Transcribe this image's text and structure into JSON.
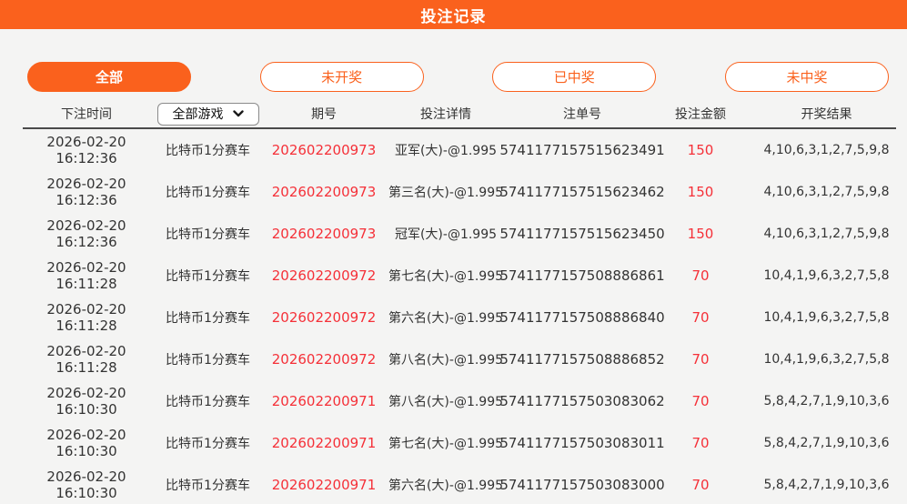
{
  "header": {
    "title": "投注记录"
  },
  "filters": {
    "all": "全部",
    "pending": "未开奖",
    "won": "已中奖",
    "lost": "未中奖"
  },
  "table": {
    "headers": {
      "time": "下注时间",
      "period": "期号",
      "detail": "投注详情",
      "order": "注单号",
      "amount": "投注金额",
      "result": "开奖结果"
    },
    "game_filter": {
      "selected": "全部游戏"
    },
    "rows": [
      {
        "time": "2026-02-20 16:12:36",
        "game": "比特币1分赛车",
        "period": "202602200973",
        "detail": "亚军(大)-@1.995",
        "order": "5741177157515623491",
        "amount": "150",
        "result": "4,10,6,3,1,2,7,5,9,8"
      },
      {
        "time": "2026-02-20 16:12:36",
        "game": "比特币1分赛车",
        "period": "202602200973",
        "detail": "第三名(大)-@1.995",
        "order": "5741177157515623462",
        "amount": "150",
        "result": "4,10,6,3,1,2,7,5,9,8"
      },
      {
        "time": "2026-02-20 16:12:36",
        "game": "比特币1分赛车",
        "period": "202602200973",
        "detail": "冠军(大)-@1.995",
        "order": "5741177157515623450",
        "amount": "150",
        "result": "4,10,6,3,1,2,7,5,9,8"
      },
      {
        "time": "2026-02-20 16:11:28",
        "game": "比特币1分赛车",
        "period": "202602200972",
        "detail": "第七名(大)-@1.995",
        "order": "5741177157508886861",
        "amount": "70",
        "result": "10,4,1,9,6,3,2,7,5,8"
      },
      {
        "time": "2026-02-20 16:11:28",
        "game": "比特币1分赛车",
        "period": "202602200972",
        "detail": "第六名(大)-@1.995",
        "order": "5741177157508886840",
        "amount": "70",
        "result": "10,4,1,9,6,3,2,7,5,8"
      },
      {
        "time": "2026-02-20 16:11:28",
        "game": "比特币1分赛车",
        "period": "202602200972",
        "detail": "第八名(大)-@1.995",
        "order": "5741177157508886852",
        "amount": "70",
        "result": "10,4,1,9,6,3,2,7,5,8"
      },
      {
        "time": "2026-02-20 16:10:30",
        "game": "比特币1分赛车",
        "period": "202602200971",
        "detail": "第八名(大)-@1.995",
        "order": "5741177157503083062",
        "amount": "70",
        "result": "5,8,4,2,7,1,9,10,3,6"
      },
      {
        "time": "2026-02-20 16:10:30",
        "game": "比特币1分赛车",
        "period": "202602200971",
        "detail": "第七名(大)-@1.995",
        "order": "5741177157503083011",
        "amount": "70",
        "result": "5,8,4,2,7,1,9,10,3,6"
      },
      {
        "time": "2026-02-20 16:10:30",
        "game": "比特币1分赛车",
        "period": "202602200971",
        "detail": "第六名(大)-@1.995",
        "order": "5741177157503083000",
        "amount": "70",
        "result": "5,8,4,2,7,1,9,10,3,6"
      }
    ]
  },
  "colors": {
    "accent_orange": "#fa611d",
    "highlight_red": "#f53038"
  }
}
